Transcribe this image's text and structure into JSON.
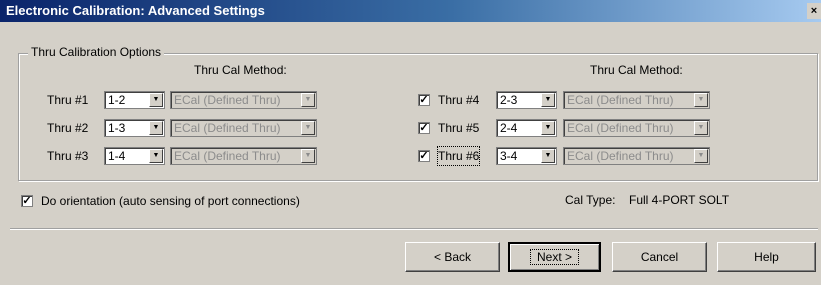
{
  "window": {
    "title": "Electronic Calibration: Advanced Settings",
    "close_glyph": "×"
  },
  "group": {
    "legend": "Thru Calibration Options",
    "method_header_left": "Thru Cal Method:",
    "method_header_right": "Thru Cal Method:"
  },
  "thrus_left": [
    {
      "label": "Thru #1",
      "ports": "1-2",
      "method": "ECal (Defined Thru)"
    },
    {
      "label": "Thru #2",
      "ports": "1-3",
      "method": "ECal (Defined Thru)"
    },
    {
      "label": "Thru #3",
      "ports": "1-4",
      "method": "ECal (Defined Thru)"
    }
  ],
  "thrus_right": [
    {
      "label": "Thru #4",
      "ports": "2-3",
      "method": "ECal (Defined Thru)",
      "checked": true,
      "check_glyph": "✓"
    },
    {
      "label": "Thru #5",
      "ports": "2-4",
      "method": "ECal (Defined Thru)",
      "checked": true,
      "check_glyph": "✓"
    },
    {
      "label": "Thru #6",
      "ports": "3-4",
      "method": "ECal (Defined Thru)",
      "checked": true,
      "check_glyph": "✓"
    }
  ],
  "orientation": {
    "label": "Do orientation (auto sensing of port connections)",
    "checked": true,
    "check_glyph": "✓"
  },
  "cal_type": {
    "label": "Cal Type:",
    "value": "Full 4-PORT SOLT"
  },
  "buttons": {
    "back": "< Back",
    "next": "Next >",
    "cancel": "Cancel",
    "help": "Help"
  },
  "icons": {
    "combo_arrow": "▼"
  }
}
